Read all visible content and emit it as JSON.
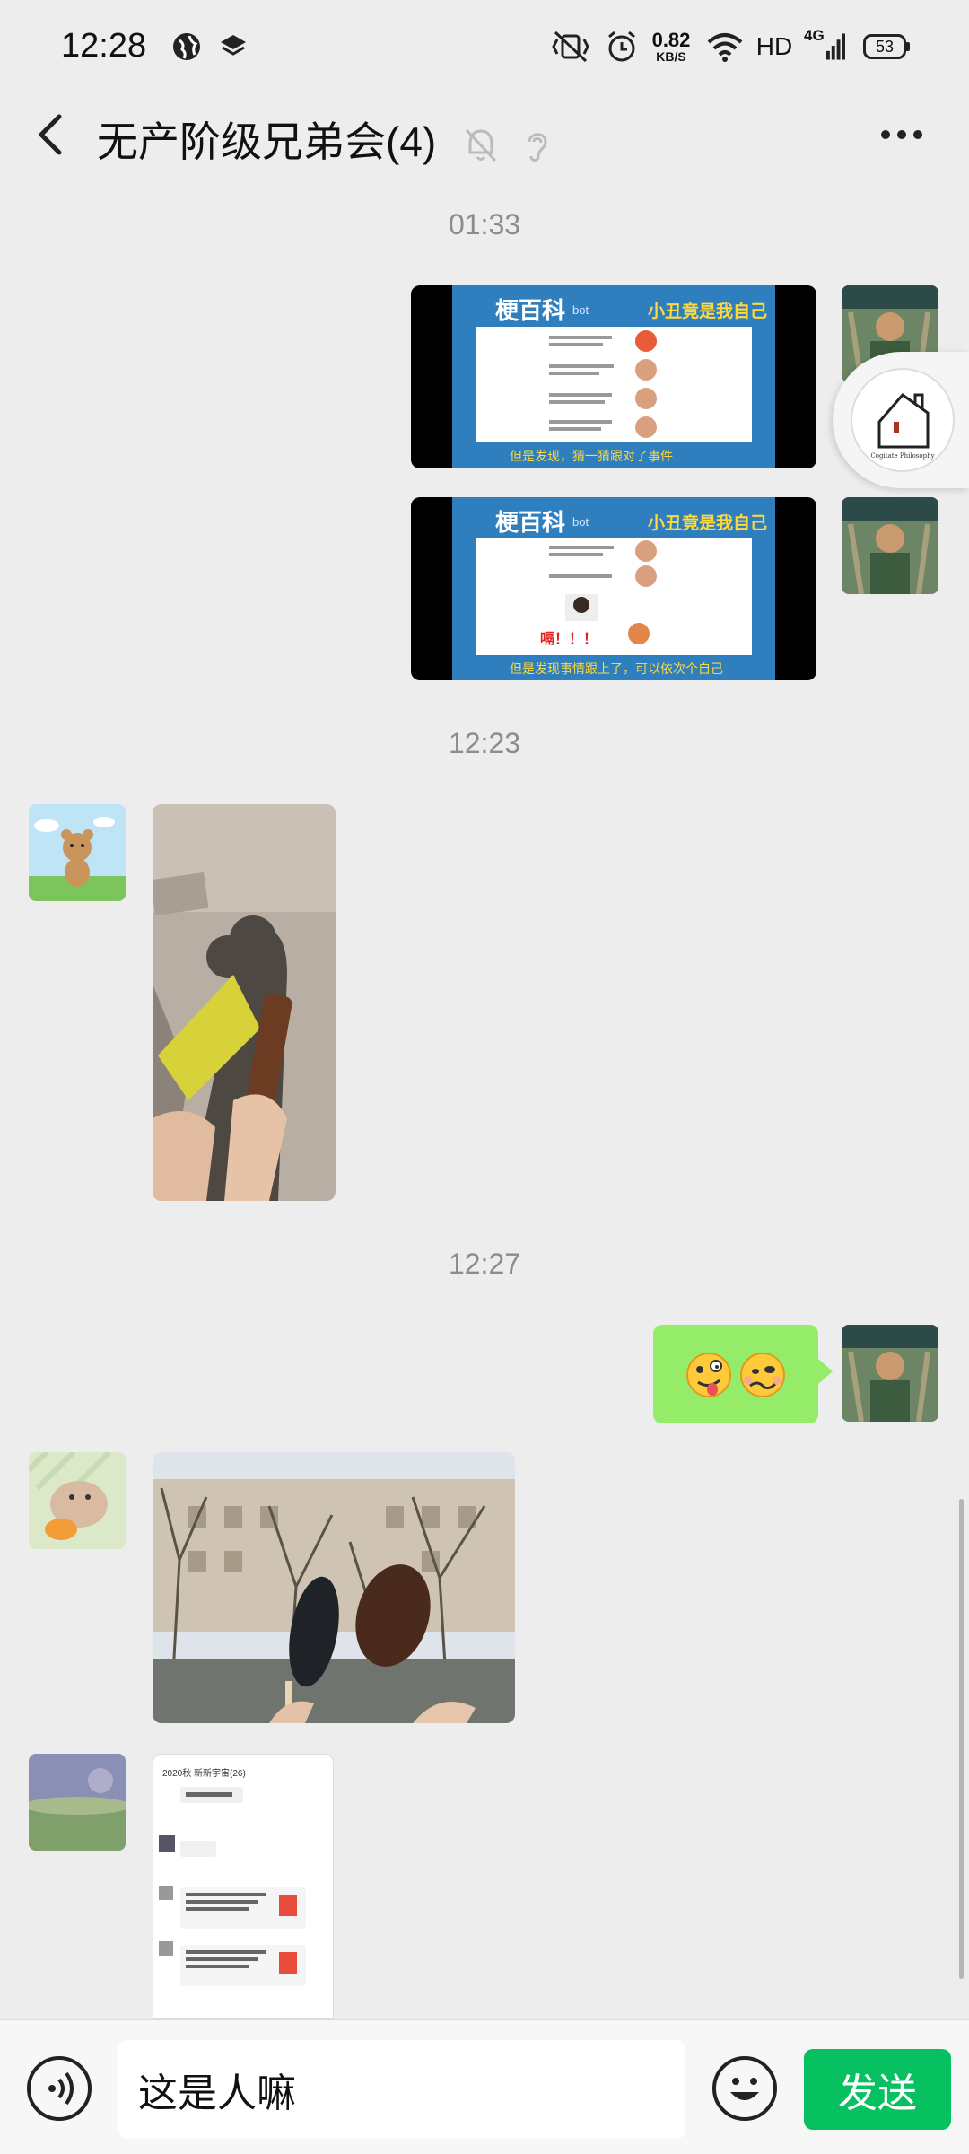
{
  "status_bar": {
    "time": "12:28",
    "net_speed_value": "0.82",
    "net_speed_unit": "KB/S",
    "hd": "HD",
    "network": "4G",
    "battery": "53"
  },
  "header": {
    "title": "无产阶级兄弟会(4)",
    "icons": [
      "back-icon",
      "mute-bell-icon",
      "ear-icon",
      "more-icon"
    ]
  },
  "messages": {
    "time_1": "01:33",
    "time_2": "12:23",
    "time_3": "12:27",
    "meme_1": {
      "brand": "梗百科",
      "brand_sub": "bot",
      "headline": "小丑竟是我自己",
      "caption": "但是发现，猜一猜跟对了事件"
    },
    "meme_2": {
      "brand": "梗百科",
      "brand_sub": "bot",
      "headline": "小丑竟是我自己",
      "shout": "嗝！！！",
      "caption": "但是发现事情跟上了，可以依次个自己"
    },
    "floater_text": "Cogitate Philosophy",
    "screenshot_title": "2020秋 新新宇宙(26)"
  },
  "input_bar": {
    "input_value": "这是人嘛",
    "send_label": "发送"
  },
  "colors": {
    "background": "#ededed",
    "bubble_green": "#95ec69",
    "send_green": "#07c160"
  }
}
